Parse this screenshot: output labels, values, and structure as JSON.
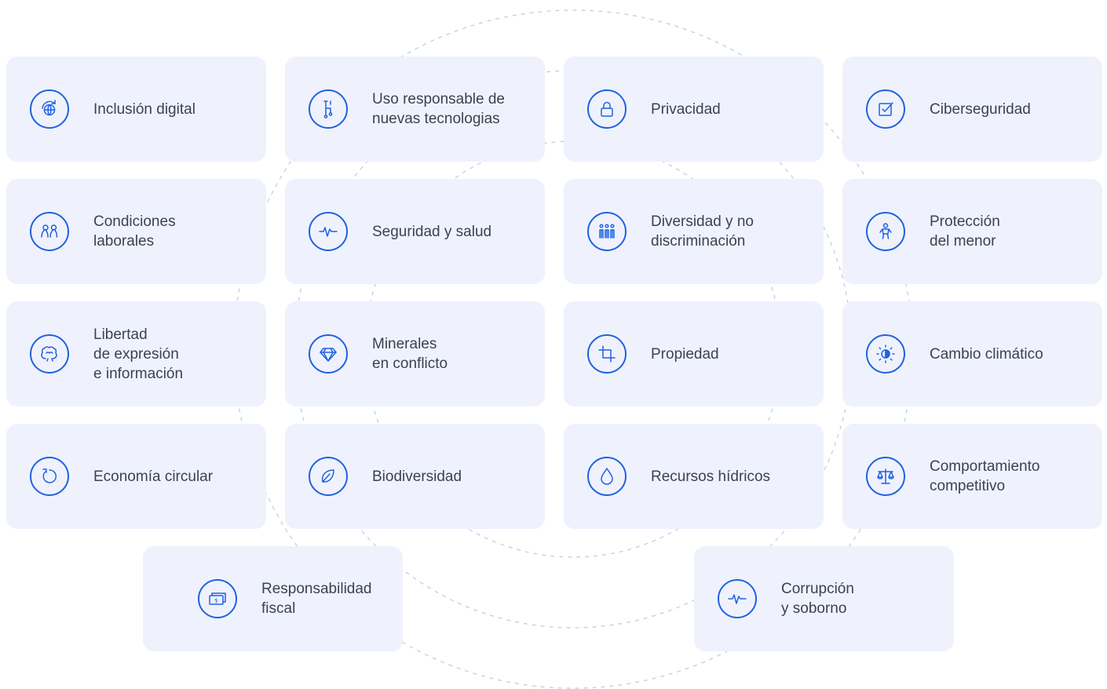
{
  "colors": {
    "accent": "#1f62e0",
    "card_bg": "#eff2fd",
    "text": "#3a4350",
    "dashes": "#c5c9d2"
  },
  "topics": [
    {
      "label": "Inclusión digital",
      "icon": "globe-refresh-icon"
    },
    {
      "label": "Uso responsable de\nnuevas tecnologias",
      "icon": "circuit-icon"
    },
    {
      "label": "Privacidad",
      "icon": "lock-icon"
    },
    {
      "label": "Ciberseguridad",
      "icon": "checkbox-icon"
    },
    {
      "label": "Condiciones\nlaborales",
      "icon": "people-icon"
    },
    {
      "label": "Seguridad y salud",
      "icon": "heartbeat-icon"
    },
    {
      "label": "Diversidad y no\ndiscriminación",
      "icon": "group-icon"
    },
    {
      "label": "Protección\ndel menor",
      "icon": "child-icon"
    },
    {
      "label": "Libertad\nde expresión\ne información",
      "icon": "brain-icon"
    },
    {
      "label": "Minerales\nen conflicto",
      "icon": "diamond-icon"
    },
    {
      "label": "Propiedad",
      "icon": "crop-icon"
    },
    {
      "label": "Cambio climático",
      "icon": "sun-icon"
    },
    {
      "label": "Economía circular",
      "icon": "refresh-icon"
    },
    {
      "label": "Biodiversidad",
      "icon": "leaf-icon"
    },
    {
      "label": "Recursos hídricos",
      "icon": "water-drop-icon"
    },
    {
      "label": "Comportamiento\ncompetitivo",
      "icon": "scale-icon"
    },
    {
      "label": "Responsabilidad\nfiscal",
      "icon": "money-icon"
    },
    {
      "label": "Corrupción\ny soborno",
      "icon": "pulse-icon"
    }
  ]
}
